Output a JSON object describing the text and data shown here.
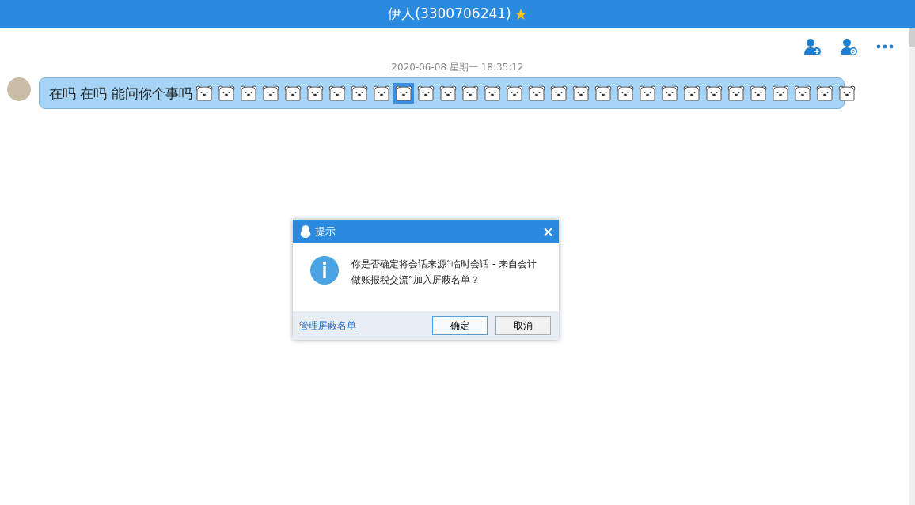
{
  "window": {
    "title": "伊人(3300706241)"
  },
  "message": {
    "timestamp": "2020-06-08 星期一 18:35:12",
    "text": "在吗 在吗 能问你个事吗",
    "emojis": [
      {
        "selected": false
      },
      {
        "selected": false
      },
      {
        "selected": false
      },
      {
        "selected": false
      },
      {
        "selected": false
      },
      {
        "selected": false
      },
      {
        "selected": false
      },
      {
        "selected": false
      },
      {
        "selected": false
      },
      {
        "selected": true
      },
      {
        "selected": false
      },
      {
        "selected": false
      },
      {
        "selected": false
      },
      {
        "selected": false
      },
      {
        "selected": false
      },
      {
        "selected": false
      },
      {
        "selected": false
      },
      {
        "selected": false
      },
      {
        "selected": false
      },
      {
        "selected": false
      },
      {
        "selected": false
      },
      {
        "selected": false
      },
      {
        "selected": false
      },
      {
        "selected": false
      },
      {
        "selected": false
      },
      {
        "selected": false
      },
      {
        "selected": false
      },
      {
        "selected": false
      },
      {
        "selected": false
      },
      {
        "selected": false
      }
    ]
  },
  "dialog": {
    "title": "提示",
    "text": "你是否确定将会话来源“临时会话 - 来自会计做账报税交流”加入屏蔽名单？",
    "link": "管理屏蔽名单",
    "buttons": [
      "确定",
      "取消"
    ]
  }
}
